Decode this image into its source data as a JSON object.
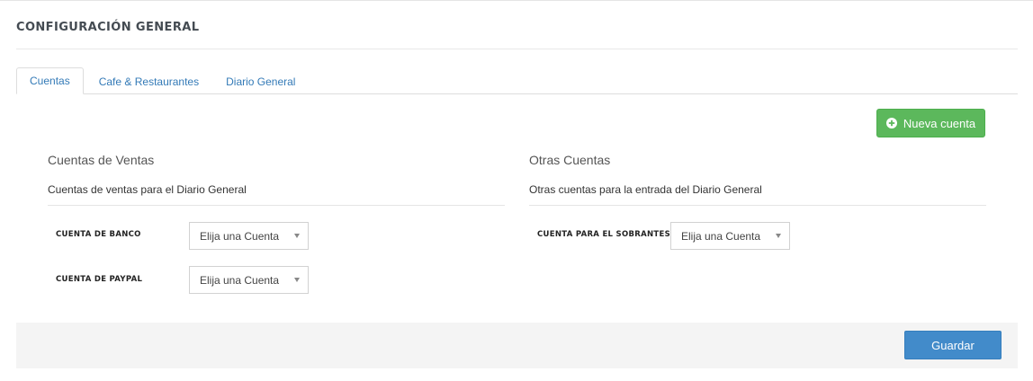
{
  "page": {
    "title": "CONFIGURACIÓN GENERAL"
  },
  "tabs": [
    {
      "label": "Cuentas",
      "active": true
    },
    {
      "label": "Cafe & Restaurantes",
      "active": false
    },
    {
      "label": "Diario General",
      "active": false
    }
  ],
  "toolbar": {
    "new_account_label": "Nueva cuenta",
    "new_account_icon": "plus-circle-icon"
  },
  "sales_accounts": {
    "title": "Cuentas de Ventas",
    "description": "Cuentas de ventas para el Diario General",
    "fields": [
      {
        "label": "CUENTA DE BANCO",
        "value": "Elija una Cuenta"
      },
      {
        "label": "CUENTA DE PAYPAL",
        "value": "Elija una Cuenta"
      }
    ]
  },
  "other_accounts": {
    "title": "Otras Cuentas",
    "description": "Otras cuentas para la entrada del Diario General",
    "fields": [
      {
        "label": "CUENTA PARA EL SOBRANTES",
        "value": "Elija una Cuenta"
      }
    ]
  },
  "footer": {
    "save_label": "Guardar"
  },
  "colors": {
    "success": "#5cb85c",
    "primary": "#428bca",
    "link": "#337ab7"
  }
}
